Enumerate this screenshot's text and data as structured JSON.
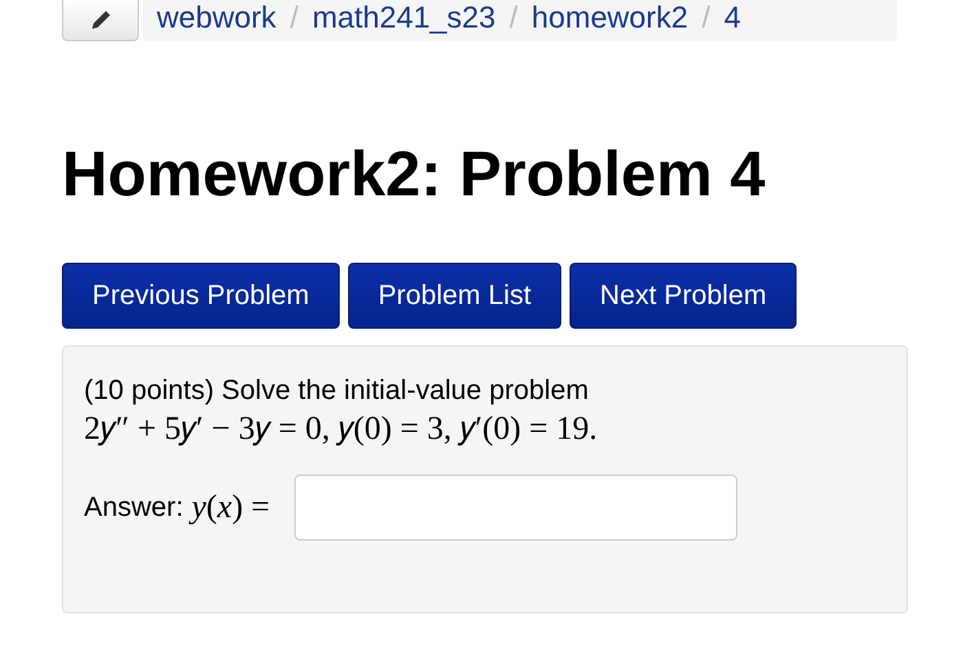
{
  "breadcrumb": {
    "separator": "/",
    "items": [
      {
        "label": "webwork"
      },
      {
        "label": "math241_s23"
      },
      {
        "label": "homework2"
      },
      {
        "label": "4"
      }
    ]
  },
  "title": "Homework2: Problem 4",
  "nav_buttons": [
    "Previous Problem",
    "Problem List",
    "Next Problem"
  ],
  "problem": {
    "statement": "(10 points) Solve the initial-value problem",
    "equation": "2𝑦″ + 5𝑦′ − 3𝑦 = 0,  𝑦(0) = 3,  𝑦′(0) = 19.",
    "answer_label": "Answer:",
    "answer_math": "*y*(*x*) ="
  }
}
